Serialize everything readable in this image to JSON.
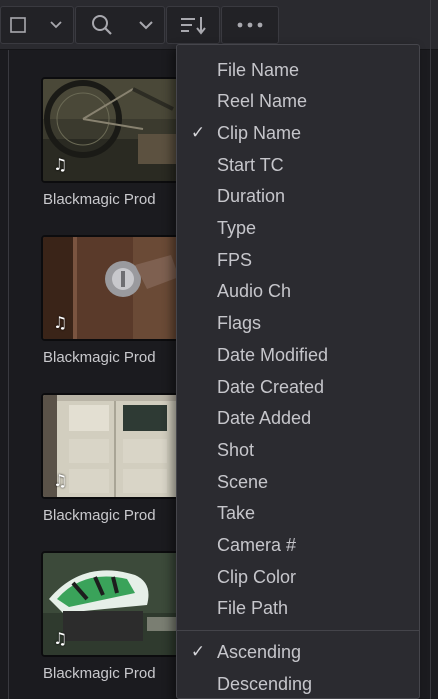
{
  "toolbar": {
    "icons": [
      "view-mode-icon",
      "chevron-down-icon",
      "search-icon",
      "chevron-down-icon",
      "sort-icon",
      "more-options-icon"
    ]
  },
  "clips": [
    {
      "name": "Blackmagic Prod",
      "audio_icon": "♫",
      "thumbnail": "bicycle"
    },
    {
      "name": "Blackmagic Prod",
      "audio_icon": "♫",
      "thumbnail": "door-lock"
    },
    {
      "name": "Blackmagic Prod",
      "audio_icon": "♫",
      "thumbnail": "garage-door"
    },
    {
      "name": "Blackmagic Prod",
      "audio_icon": "♫",
      "thumbnail": "cyclist-helmet"
    }
  ],
  "sort_menu": {
    "fields": [
      {
        "label": "File Name",
        "checked": false
      },
      {
        "label": "Reel Name",
        "checked": false
      },
      {
        "label": "Clip Name",
        "checked": true
      },
      {
        "label": "Start TC",
        "checked": false
      },
      {
        "label": "Duration",
        "checked": false
      },
      {
        "label": "Type",
        "checked": false
      },
      {
        "label": "FPS",
        "checked": false
      },
      {
        "label": "Audio Ch",
        "checked": false
      },
      {
        "label": "Flags",
        "checked": false
      },
      {
        "label": "Date Modified",
        "checked": false
      },
      {
        "label": "Date Created",
        "checked": false
      },
      {
        "label": "Date Added",
        "checked": false
      },
      {
        "label": "Shot",
        "checked": false
      },
      {
        "label": "Scene",
        "checked": false
      },
      {
        "label": "Take",
        "checked": false
      },
      {
        "label": "Camera #",
        "checked": false
      },
      {
        "label": "Clip Color",
        "checked": false
      },
      {
        "label": "File Path",
        "checked": false
      }
    ],
    "order": [
      {
        "label": "Ascending",
        "checked": true
      },
      {
        "label": "Descending",
        "checked": false
      }
    ],
    "check_glyph": "✓"
  }
}
